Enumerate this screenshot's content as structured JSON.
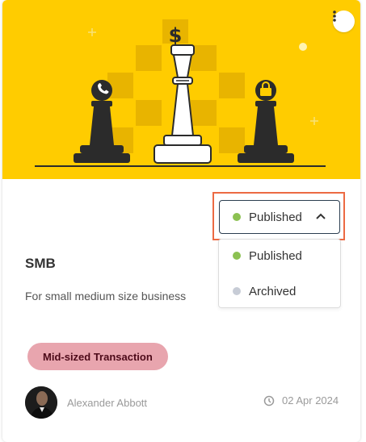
{
  "card": {
    "title": "SMB",
    "description": "For small medium size business",
    "tag": "Mid-sized Transaction",
    "author": "Alexander Abbott",
    "date": "02 Apr 2024"
  },
  "status": {
    "selected": "Published",
    "options": [
      {
        "label": "Published",
        "color": "#8cc152"
      },
      {
        "label": "Archived",
        "color": "#c7ccd6"
      }
    ]
  },
  "colors": {
    "hero_bg": "#ffcc00",
    "highlight_border": "#ec6a43",
    "tag_bg": "#e8a5ae",
    "tag_text": "#4d0a19"
  },
  "icons": {
    "menu": "kebab-icon",
    "dollar": "dollar-icon",
    "phone": "phone-icon",
    "lock": "lock-icon",
    "chevron": "chevron-up-icon",
    "clock": "clock-icon"
  }
}
